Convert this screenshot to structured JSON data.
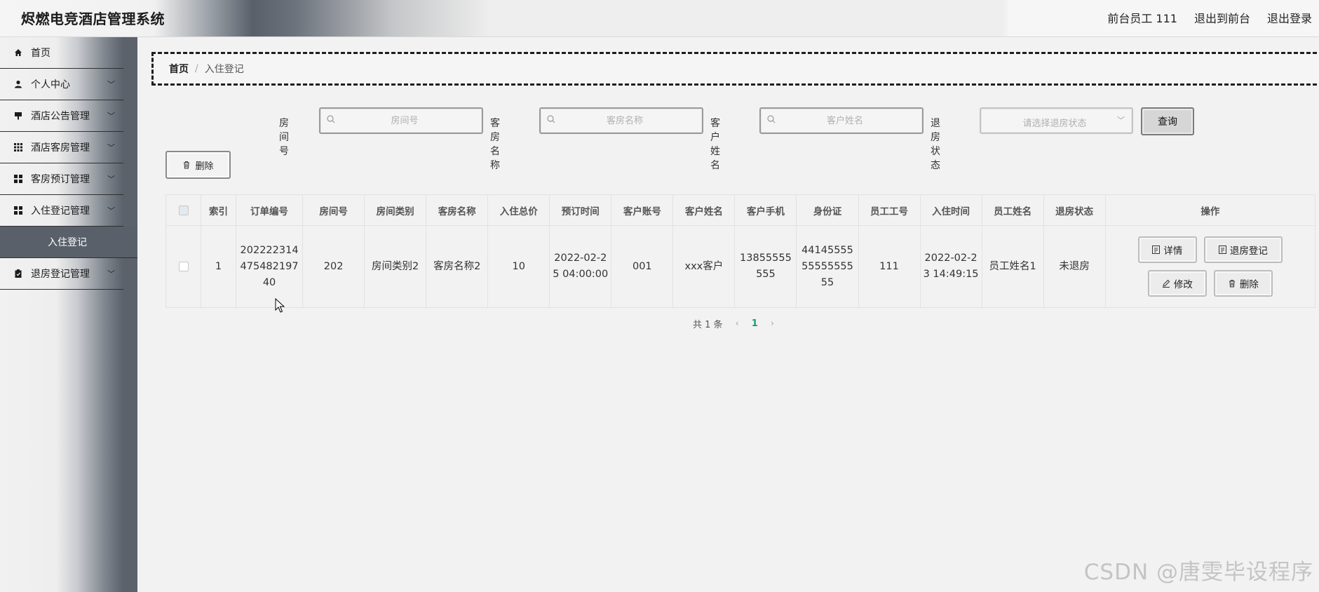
{
  "header": {
    "title": "烬燃电竞酒店管理系统",
    "user_label": "前台员工 111",
    "exit_front_label": "退出到前台",
    "logout_label": "退出登录"
  },
  "sidebar": {
    "items": [
      {
        "label": "首页",
        "icon": "home-icon"
      },
      {
        "label": "个人中心",
        "icon": "user-icon"
      },
      {
        "label": "酒店公告管理",
        "icon": "notice-icon"
      },
      {
        "label": "酒店客房管理",
        "icon": "grid-icon"
      },
      {
        "label": "客房预订管理",
        "icon": "apps-icon"
      },
      {
        "label": "入住登记管理",
        "icon": "apps-icon"
      },
      {
        "label": "退房登记管理",
        "icon": "clipboard-icon"
      }
    ],
    "active_sub_label": "入住登记"
  },
  "breadcrumb": {
    "home": "首页",
    "separator": "/",
    "current": "入住登记"
  },
  "search": {
    "room_no_label": "房间号",
    "room_no_placeholder": "房间号",
    "room_name_label": "客房名称",
    "room_name_placeholder": "客房名称",
    "customer_name_label": "客户姓名",
    "customer_name_placeholder": "客户姓名",
    "checkout_status_label": "退房状态",
    "checkout_status_placeholder": "请选择退房状态",
    "query_label": "查询"
  },
  "toolbar": {
    "delete_label": "删除"
  },
  "table": {
    "columns": [
      "索引",
      "订单编号",
      "房间号",
      "房间类别",
      "客房名称",
      "入住总价",
      "预订时间",
      "客户账号",
      "客户姓名",
      "客户手机",
      "身份证",
      "员工工号",
      "入住时间",
      "员工姓名",
      "退房状态",
      "操作"
    ],
    "rows": [
      {
        "cells": [
          "1",
          "20222231447548219740",
          "202",
          "房间类别2",
          "客房名称2",
          "10",
          "2022-02-25 04:00:00",
          "001",
          "xxx客户",
          "13855555555",
          "441455555555555555",
          "111",
          "2022-02-23 14:49:15",
          "员工姓名1",
          "未退房"
        ],
        "actions": {
          "detail": "详情",
          "checkout": "退房登记",
          "edit": "修改",
          "delete": "删除"
        }
      }
    ]
  },
  "pagination": {
    "total_label": "共 1 条",
    "current_page": "1"
  },
  "watermark": "CSDN @唐雯毕设程序"
}
